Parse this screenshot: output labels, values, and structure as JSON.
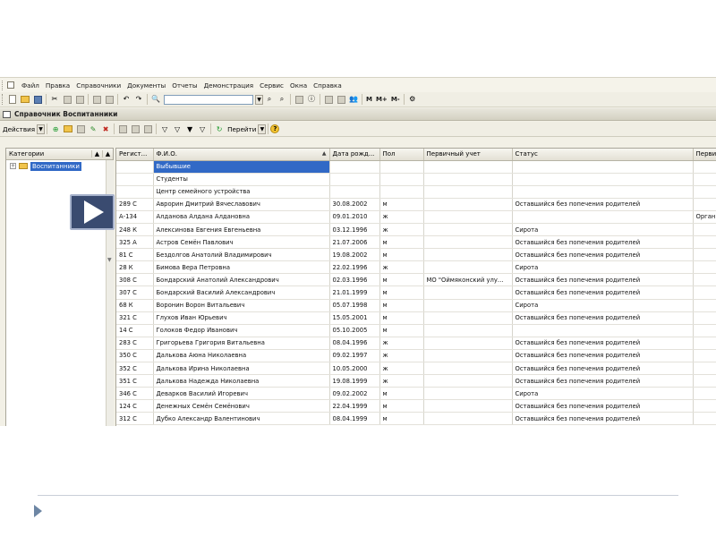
{
  "menu": {
    "items": [
      "Файл",
      "Правка",
      "Справочники",
      "Документы",
      "Отчеты",
      "Демонстрация",
      "Сервис",
      "Окна",
      "Справка"
    ]
  },
  "toolbar": {
    "memory_buttons": [
      "M",
      "M+",
      "M-"
    ]
  },
  "window": {
    "title": "Справочник Воспитанники"
  },
  "actionbar": {
    "actions_label": "Действия",
    "goto_label": "Перейти",
    "help_glyph": "?"
  },
  "categories": {
    "header": "Категории",
    "items": [
      {
        "label": "Воспитанники",
        "selected": true
      }
    ]
  },
  "table": {
    "columns": [
      "Регист...",
      "Ф.И.О.",
      "Дата рожд...",
      "Пол",
      "Первичный учет",
      "Статус",
      "Перви"
    ],
    "group_rows": [
      "Выбывшие",
      "Студенты",
      "Центр семейного устройства"
    ],
    "rows": [
      {
        "reg": "289 С",
        "fio": "Аврорин Дмитрий Вячеславович",
        "dob": "30.08.2002",
        "sex": "м",
        "primary": "",
        "status": "Оставшийся без попечения родителей",
        "extra": ""
      },
      {
        "reg": "А-134",
        "fio": "Алданова Алдана Алдановна",
        "dob": "09.01.2010",
        "sex": "ж",
        "primary": "",
        "status": "",
        "extra": "Орган"
      },
      {
        "reg": "248 К",
        "fio": "Алексинова Евгения Евгеньевна",
        "dob": "03.12.1996",
        "sex": "ж",
        "primary": "",
        "status": "Сирота",
        "extra": ""
      },
      {
        "reg": "325 А",
        "fio": "Астров Семён Павлович",
        "dob": "21.07.2006",
        "sex": "м",
        "primary": "",
        "status": "Оставшийся без попечения родителей",
        "extra": ""
      },
      {
        "reg": "81 С",
        "fio": "Бездолгов Анатолий Владимирович",
        "dob": "19.08.2002",
        "sex": "м",
        "primary": "",
        "status": "Оставшийся без попечения родителей",
        "extra": ""
      },
      {
        "reg": "28 К",
        "fio": "Бимова Вера Петровна",
        "dob": "22.02.1996",
        "sex": "ж",
        "primary": "",
        "status": "Сирота",
        "extra": ""
      },
      {
        "reg": "308 С",
        "fio": "Бондарский Анатолий Александрович",
        "dob": "02.03.1996",
        "sex": "м",
        "primary": "МО \"Оймяконский улу...",
        "status": "Оставшийся без попечения родителей",
        "extra": ""
      },
      {
        "reg": "307 С",
        "fio": "Бондарский Василий Александрович",
        "dob": "21.01.1999",
        "sex": "м",
        "primary": "",
        "status": "Оставшийся без попечения родителей",
        "extra": ""
      },
      {
        "reg": "68 К",
        "fio": "Воронин Ворон Витальевич",
        "dob": "05.07.1998",
        "sex": "м",
        "primary": "",
        "status": "Сирота",
        "extra": ""
      },
      {
        "reg": "321 С",
        "fio": "Глухов Иван Юрьевич",
        "dob": "15.05.2001",
        "sex": "м",
        "primary": "",
        "status": "Оставшийся без попечения родителей",
        "extra": ""
      },
      {
        "reg": "14 С",
        "fio": "Голоков Федор Иванович",
        "dob": "05.10.2005",
        "sex": "м",
        "primary": "",
        "status": "",
        "extra": ""
      },
      {
        "reg": "283 С",
        "fio": "Григорьева Григория Витальевна",
        "dob": "08.04.1996",
        "sex": "ж",
        "primary": "",
        "status": "Оставшийся без попечения родителей",
        "extra": ""
      },
      {
        "reg": "350 С",
        "fio": "Далькова Аюна Николаевна",
        "dob": "09.02.1997",
        "sex": "ж",
        "primary": "",
        "status": "Оставшийся без попечения родителей",
        "extra": ""
      },
      {
        "reg": "352 С",
        "fio": "Далькова Ирина Николаевна",
        "dob": "10.05.2000",
        "sex": "ж",
        "primary": "",
        "status": "Оставшийся без попечения родителей",
        "extra": ""
      },
      {
        "reg": "351 С",
        "fio": "Далькова Надежда Николаевна",
        "dob": "19.08.1999",
        "sex": "ж",
        "primary": "",
        "status": "Оставшийся без попечения родителей",
        "extra": ""
      },
      {
        "reg": "346 С",
        "fio": "Деварков Василий Игоревич",
        "dob": "09.02.2002",
        "sex": "м",
        "primary": "",
        "status": "Сирота",
        "extra": ""
      },
      {
        "reg": "124 С",
        "fio": "Денежных Семён Семёнович",
        "dob": "22.04.1999",
        "sex": "м",
        "primary": "",
        "status": "Оставшийся без попечения родителей",
        "extra": ""
      },
      {
        "reg": "312 С",
        "fio": "Дубко Александр Валентинович",
        "dob": "08.04.1999",
        "sex": "м",
        "primary": "",
        "status": "Оставшийся без попечения родителей",
        "extra": ""
      }
    ]
  },
  "colors": {
    "selection": "#3169c6",
    "play_button": "#3a4b70",
    "nav_arrow": "#6d86a4"
  },
  "icons": [
    "folder-icon",
    "save-icon",
    "cut-icon",
    "copy-icon",
    "paste-icon",
    "print-icon",
    "undo-icon",
    "redo-icon",
    "search-icon",
    "help-icon",
    "play-icon",
    "next-slide-arrow-icon"
  ]
}
